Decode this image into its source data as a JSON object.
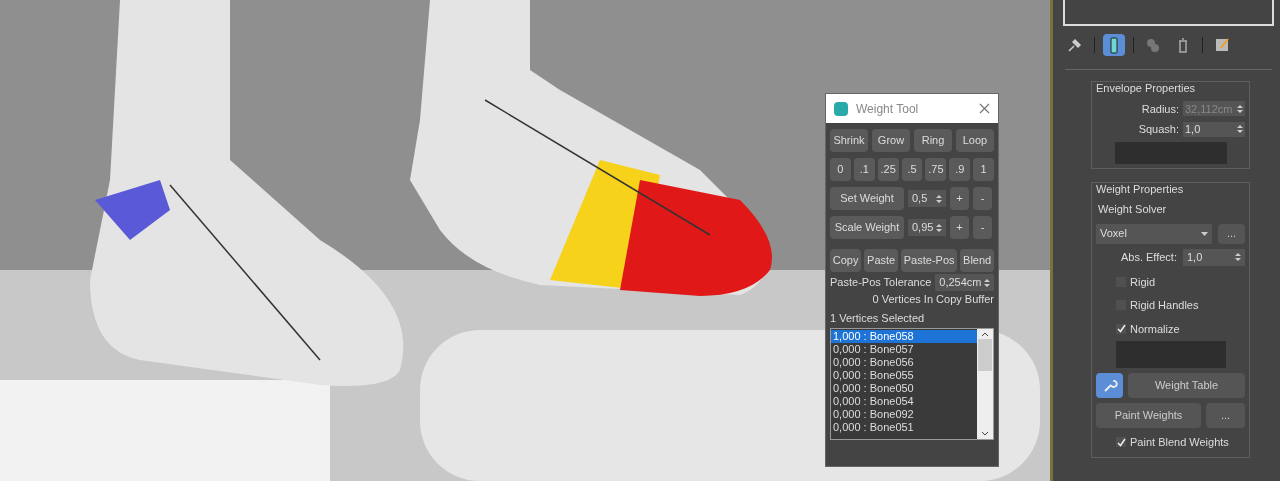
{
  "weight_tool": {
    "title": "Weight Tool",
    "loop_buttons": [
      "Shrink",
      "Grow",
      "Ring",
      "Loop"
    ],
    "preset_buttons": [
      "0",
      ".1",
      ".25",
      ".5",
      ".75",
      ".9",
      "1"
    ],
    "set_weight": {
      "label": "Set Weight",
      "value": "0,5",
      "plus": "+",
      "minus": "-"
    },
    "scale_weight": {
      "label": "Scale Weight",
      "value": "0,95",
      "plus": "+",
      "minus": "-"
    },
    "copy_buttons": [
      "Copy",
      "Paste",
      "Paste-Pos",
      "Blend"
    ],
    "tolerance": {
      "label": "Paste-Pos Tolerance",
      "value": "0,254cm"
    },
    "copy_buffer": "0 Vertices In Copy Buffer",
    "selected_count": "1 Vertices Selected",
    "bones": [
      {
        "text": "1,000 : Bone058",
        "selected": true
      },
      {
        "text": "0,000 : Bone057",
        "selected": false
      },
      {
        "text": "0,000 : Bone056",
        "selected": false
      },
      {
        "text": "0,000 : Bone055",
        "selected": false
      },
      {
        "text": "0,000 : Bone050",
        "selected": false
      },
      {
        "text": "0,000 : Bone054",
        "selected": false
      },
      {
        "text": "0,000 : Bone092",
        "selected": false
      },
      {
        "text": "0,000 : Bone051",
        "selected": false
      }
    ]
  },
  "command_panel": {
    "toolbar": [
      {
        "kind": "pin",
        "selected": false
      },
      {
        "kind": "stack",
        "selected": true
      },
      {
        "kind": "unique",
        "selected": false
      },
      {
        "kind": "trash",
        "selected": false
      },
      {
        "kind": "config",
        "selected": false
      }
    ],
    "envelope": {
      "title": "Envelope Properties",
      "fields": [
        {
          "label": "Radius:",
          "value": "32,112cm",
          "disabled": true
        },
        {
          "label": "Squash:",
          "value": "1,0",
          "disabled": false
        }
      ]
    },
    "weight": {
      "title": "Weight Properties",
      "solver_label": "Weight Solver",
      "solver": "Voxel",
      "more": "...",
      "abs_effect": {
        "label": "Abs. Effect:",
        "value": "1,0"
      },
      "checks": [
        {
          "label": "Rigid",
          "checked": false
        },
        {
          "label": "Rigid Handles",
          "checked": false
        },
        {
          "label": "Normalize",
          "checked": true
        }
      ],
      "weight_tool_active": true,
      "weight_table": "Weight Table",
      "paint_weights": "Paint Weights",
      "paint_more": "...",
      "paint_blend": {
        "label": "Paint Blend Weights",
        "checked": true
      }
    }
  }
}
